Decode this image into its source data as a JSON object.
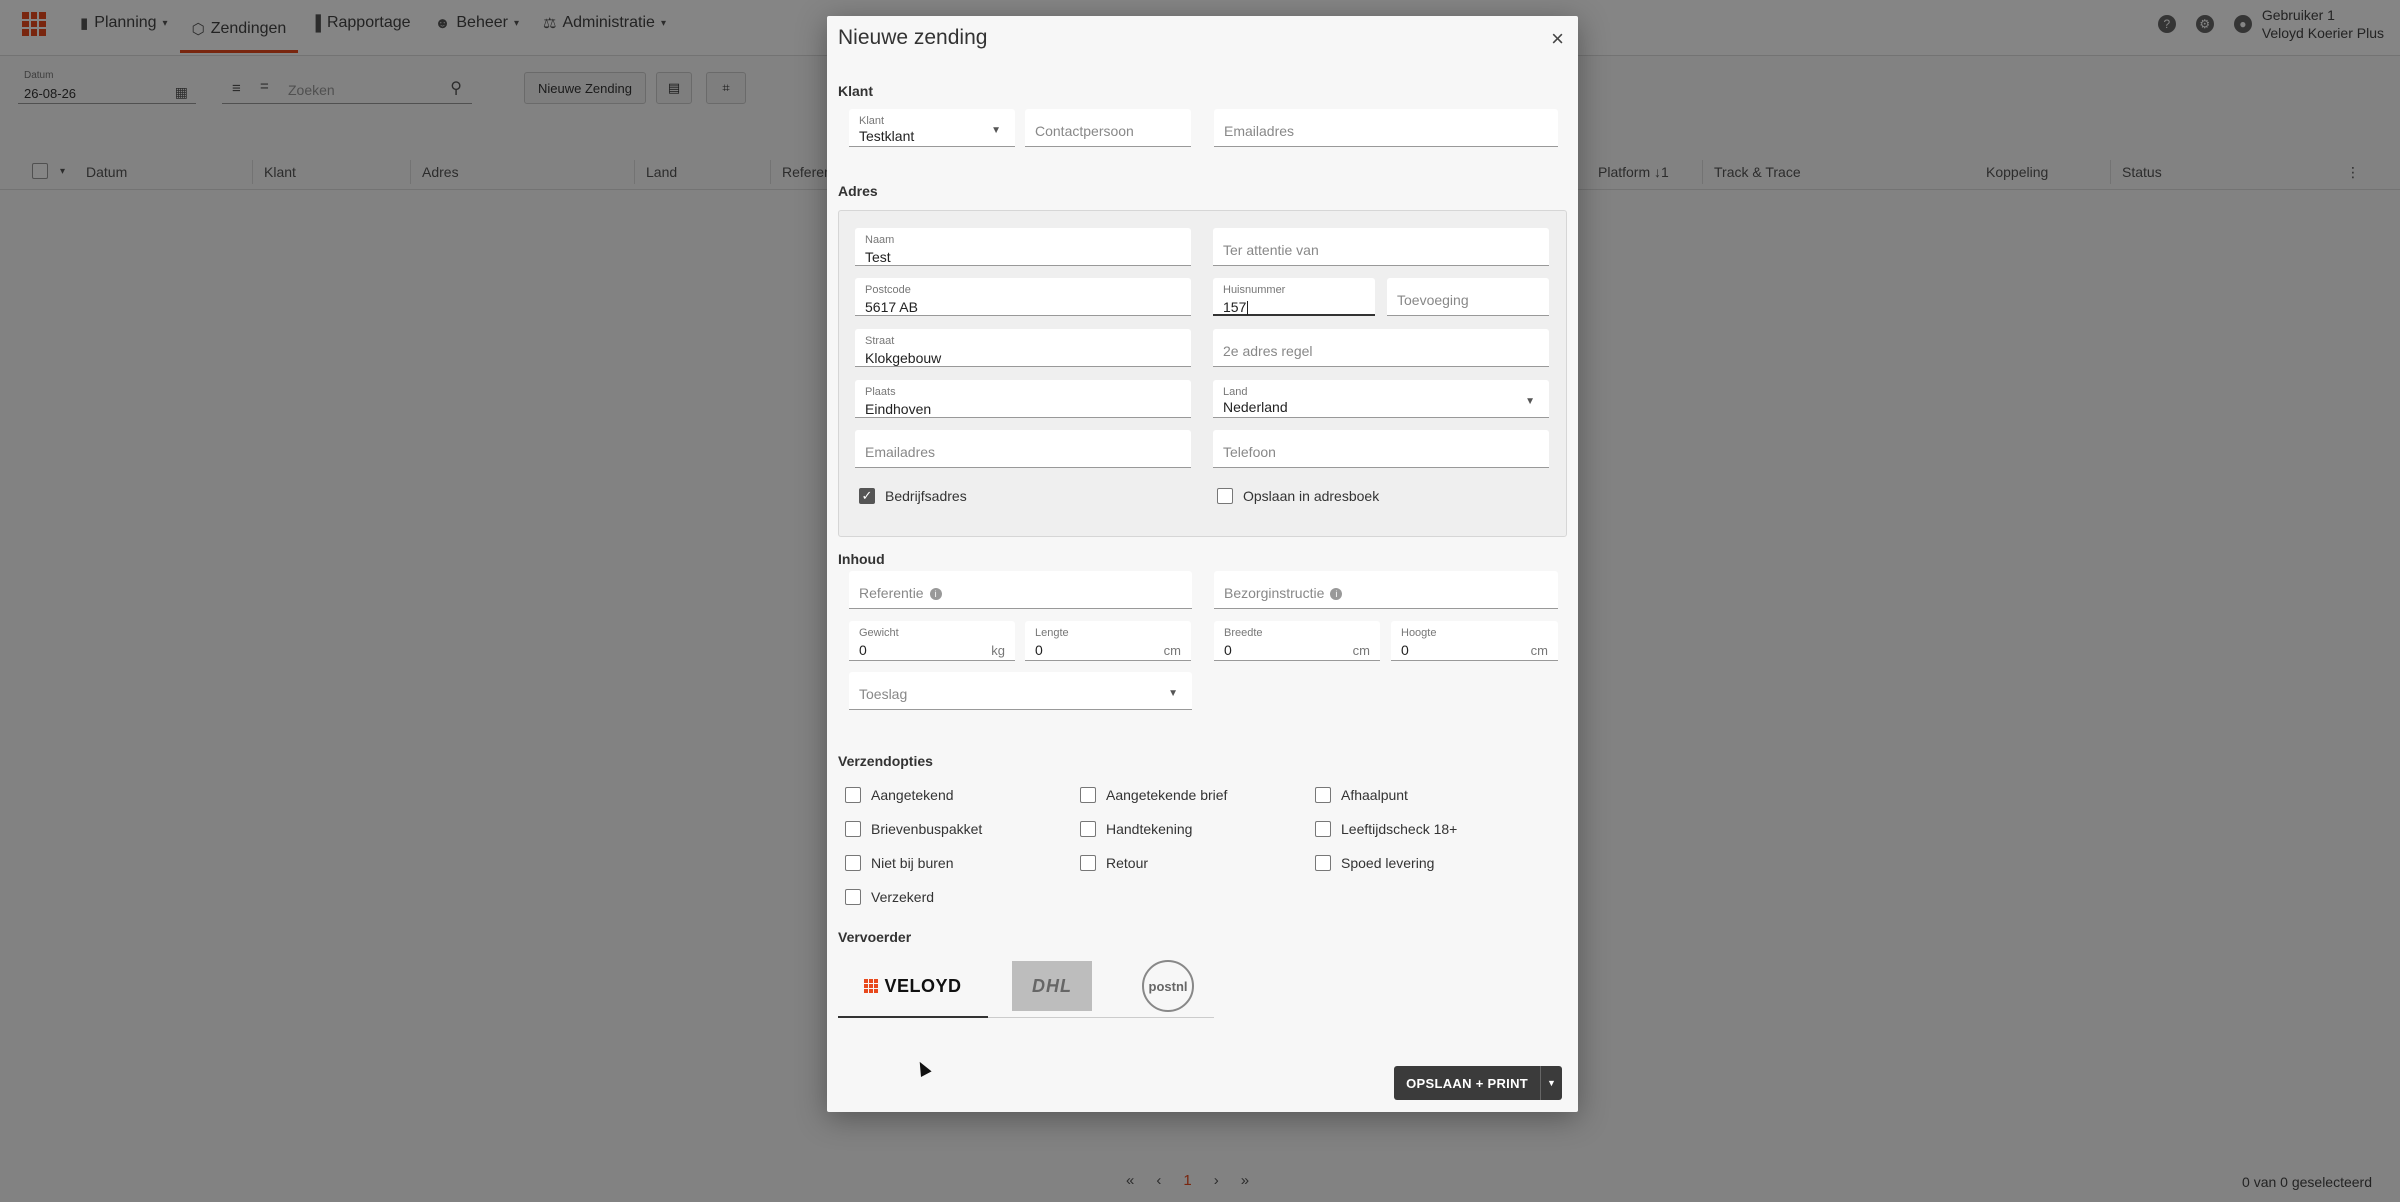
{
  "app": {
    "nav": [
      {
        "label": "Planning",
        "icon": "map-icon",
        "dropdown": true
      },
      {
        "label": "Zendingen",
        "icon": "box-icon",
        "dropdown": false
      },
      {
        "label": "Rapportage",
        "icon": "bar-chart-icon",
        "dropdown": false
      },
      {
        "label": "Beheer",
        "icon": "people-icon",
        "dropdown": true
      },
      {
        "label": "Administratie",
        "icon": "finance-icon",
        "dropdown": true
      }
    ],
    "user": {
      "name": "Gebruiker 1",
      "company": "Veloyd Koerier Plus"
    }
  },
  "toolbar": {
    "date_label": "Datum",
    "date_value": "26-08-26",
    "search_placeholder": "Zoeken",
    "new_shipment": "Nieuwe Zending"
  },
  "table": {
    "columns": [
      "Datum",
      "Klant",
      "Adres",
      "Land",
      "Referen",
      "Platform ↓1",
      "Track & Trace",
      "Koppeling",
      "Status"
    ]
  },
  "pager": {
    "first": "«",
    "prev": "‹",
    "current": "1",
    "next": "›",
    "last": "»",
    "selected": "0 van 0 geselecteerd"
  },
  "modal": {
    "title": "Nieuwe zending",
    "close": "×",
    "sections": {
      "klant": "Klant",
      "adres": "Adres",
      "inhoud": "Inhoud",
      "verzendopties": "Verzendopties",
      "vervoerder": "Vervoerder"
    },
    "klant": {
      "klant_label": "Klant",
      "klant_value": "Testklant",
      "contact_placeholder": "Contactpersoon",
      "email_placeholder": "Emailadres"
    },
    "adres": {
      "naam_label": "Naam",
      "naam_value": "Test",
      "attentie_placeholder": "Ter attentie van",
      "postcode_label": "Postcode",
      "postcode_value": "5617 AB",
      "huisnummer_label": "Huisnummer",
      "huisnummer_value": "157",
      "toevoeging_placeholder": "Toevoeging",
      "straat_label": "Straat",
      "straat_value": "Klokgebouw",
      "regel2_placeholder": "2e adres regel",
      "plaats_label": "Plaats",
      "plaats_value": "Eindhoven",
      "land_label": "Land",
      "land_value": "Nederland",
      "email_placeholder": "Emailadres",
      "telefoon_placeholder": "Telefoon",
      "bedrijfsadres": "Bedrijfsadres",
      "bedrijfsadres_checked": true,
      "adresboek": "Opslaan in adresboek",
      "adresboek_checked": false
    },
    "inhoud": {
      "referentie_placeholder": "Referentie",
      "bezorg_placeholder": "Bezorginstructie",
      "gewicht_label": "Gewicht",
      "gewicht_value": "0",
      "gewicht_unit": "kg",
      "lengte_label": "Lengte",
      "lengte_value": "0",
      "lengte_unit": "cm",
      "breedte_label": "Breedte",
      "breedte_value": "0",
      "breedte_unit": "cm",
      "hoogte_label": "Hoogte",
      "hoogte_value": "0",
      "hoogte_unit": "cm",
      "toeslag_placeholder": "Toeslag"
    },
    "opties": [
      {
        "label": "Aangetekend",
        "checked": false
      },
      {
        "label": "Aangetekende brief",
        "checked": false
      },
      {
        "label": "Afhaalpunt",
        "checked": false
      },
      {
        "label": "Brievenbuspakket",
        "checked": false
      },
      {
        "label": "Handtekening",
        "checked": false
      },
      {
        "label": "Leeftijdscheck 18+",
        "checked": false
      },
      {
        "label": "Niet bij buren",
        "checked": false
      },
      {
        "label": "Retour",
        "checked": false
      },
      {
        "label": "Spoed levering",
        "checked": false
      },
      {
        "label": "Verzekerd",
        "checked": false
      }
    ],
    "carriers": {
      "veloyd": "VELOYD",
      "dhl": "DHL",
      "postnl": "postnl",
      "selected": "VELOYD"
    },
    "save_label": "OPSLAAN + PRINT"
  },
  "colors": {
    "accent": "#e8491d",
    "button_dark": "#3b3b3b",
    "modal_bg": "#f7f7f7"
  }
}
